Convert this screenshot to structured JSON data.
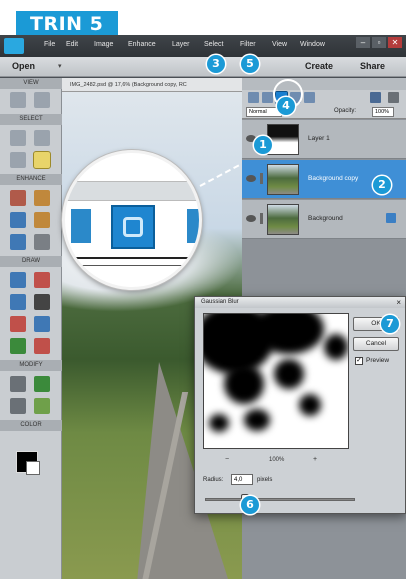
{
  "banner": {
    "label": "TRIN 5"
  },
  "menubar": {
    "items": [
      "File",
      "Edit",
      "Image",
      "Enhance",
      "Layer",
      "Select",
      "Filter",
      "View",
      "Window"
    ],
    "window_buttons": [
      "–",
      "▫",
      "✕"
    ]
  },
  "optionsbar": {
    "open": "Open",
    "create": "Create",
    "share": "Share"
  },
  "toolbox": {
    "sections": [
      "VIEW",
      "SELECT",
      "ENHANCE",
      "DRAW",
      "MODIFY",
      "COLOR"
    ]
  },
  "document": {
    "tab_title": "IMG_2482.psd @ 17,6% (Background copy, RC"
  },
  "layers_panel": {
    "blend_mode": "Normal",
    "opacity_label": "Opacity:",
    "opacity_value": "100%",
    "layers": [
      {
        "name": "Layer 1",
        "active": false
      },
      {
        "name": "Background copy",
        "active": true
      },
      {
        "name": "Background",
        "active": false
      }
    ]
  },
  "dialog": {
    "title": "Gaussian Blur",
    "close": "×",
    "ok": "OK",
    "cancel": "Cancel",
    "preview_label": "Preview",
    "preview_checked": true,
    "zoom_minus": "−",
    "zoom_value": "100%",
    "zoom_plus": "+",
    "radius_label": "Radius:",
    "radius_value": "4,0",
    "radius_unit": "pixels"
  },
  "steps": [
    "1",
    "2",
    "3",
    "4",
    "5",
    "6",
    "7"
  ],
  "colors": {
    "accent": "#1b9ad6",
    "active_layer": "#3f8fd6"
  }
}
